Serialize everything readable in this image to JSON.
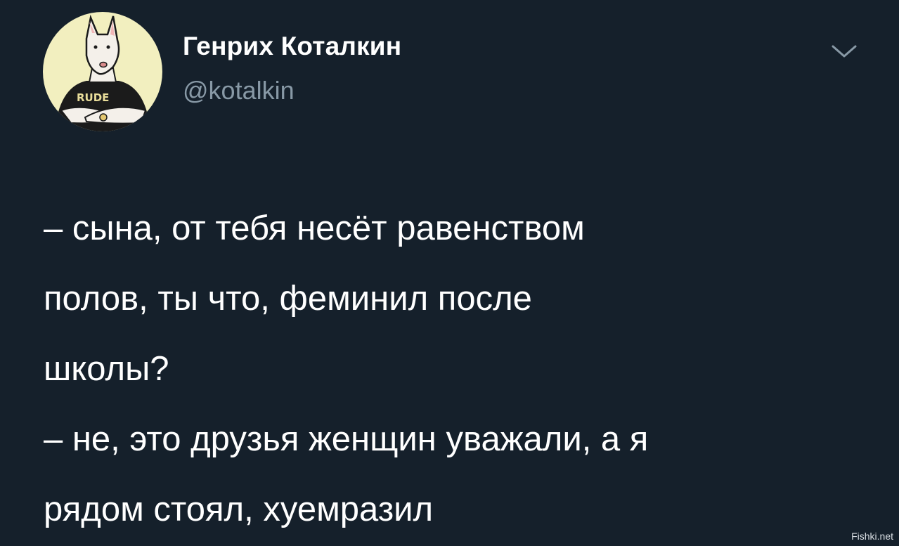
{
  "author": {
    "display_name": "Генрих Коталкин",
    "handle": "@kotalkin",
    "avatar_icon": "dog-in-rude-tshirt-avatar",
    "avatar_shirt_text": "RUDE"
  },
  "menu": {
    "icon": "chevron-down-icon"
  },
  "tweet": {
    "lines": [
      "– сына, от тебя несёт равенством",
      "полов, ты что, феминил после",
      "школы?",
      "– не, это друзья женщин уважали, а я",
      "рядом стоял, хуемразил"
    ]
  },
  "watermark": "Fishki.net",
  "colors": {
    "background": "#15202b",
    "text": "#ffffff",
    "secondary_text": "#8899a6",
    "avatar_bg": "#f2efbf"
  }
}
